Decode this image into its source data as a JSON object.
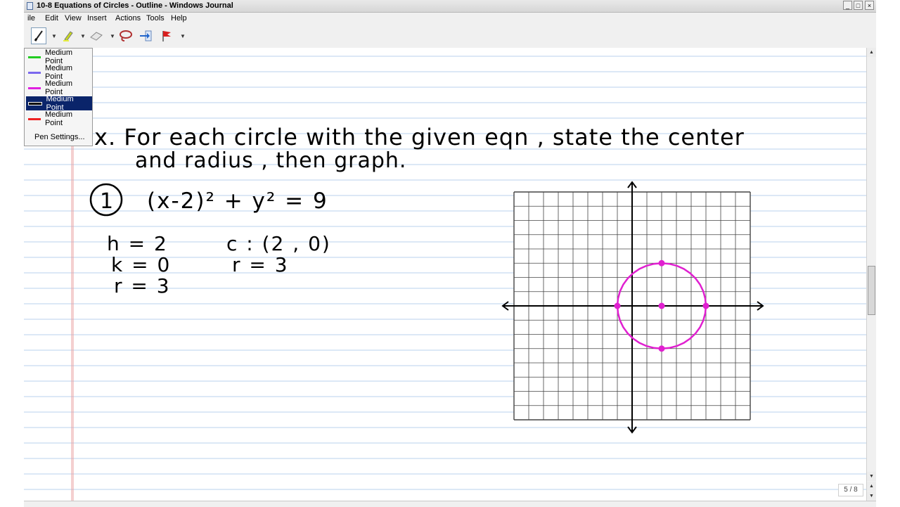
{
  "window": {
    "title": "10-8  Equations of Circles - Outline - Windows Journal",
    "minimize": "_",
    "maximize": "□",
    "close": "×"
  },
  "menu": {
    "items": [
      "ile",
      "Edit",
      "View",
      "Insert",
      "Actions",
      "Tools",
      "Help"
    ]
  },
  "toolbar": {
    "tools": [
      "pen-icon",
      "highlighter-icon",
      "eraser-icon",
      "lasso-icon",
      "insert-space-icon",
      "flag-icon"
    ]
  },
  "pen_menu": {
    "items": [
      {
        "label": "Medium Point",
        "color": "#22cc22"
      },
      {
        "label": "Medium Point",
        "color": "#7b68ee"
      },
      {
        "label": "Medium Point",
        "color": "#e020e0"
      },
      {
        "label": "Medium Point",
        "color": "#000000"
      },
      {
        "label": "Medium Point",
        "color": "#ee2222"
      }
    ],
    "selected_index": 3,
    "settings_label": "Pen Settings..."
  },
  "note": {
    "line1": "x. For each circle with the given eqn , state the center",
    "line2": "and radius , then graph.",
    "problem_number": "1",
    "equation": "(x-2)² + y² = 9",
    "work_left": [
      "h = 2",
      "k = 0",
      "r = 3"
    ],
    "work_right": [
      "c : (2 , 0)",
      "r = 3"
    ],
    "ink_color": "#000000",
    "graph_ink_color": "#e020d0"
  },
  "graph": {
    "grid_cells": 16,
    "x_range": [
      -8,
      8
    ],
    "y_range": [
      -8,
      8
    ],
    "circle": {
      "center": [
        2,
        0
      ],
      "radius": 3
    },
    "points": [
      [
        2,
        3
      ],
      [
        2,
        0
      ],
      [
        2,
        -3
      ],
      [
        -1,
        0
      ],
      [
        5,
        0
      ]
    ]
  },
  "status": {
    "page_indicator": "5 / 8"
  }
}
